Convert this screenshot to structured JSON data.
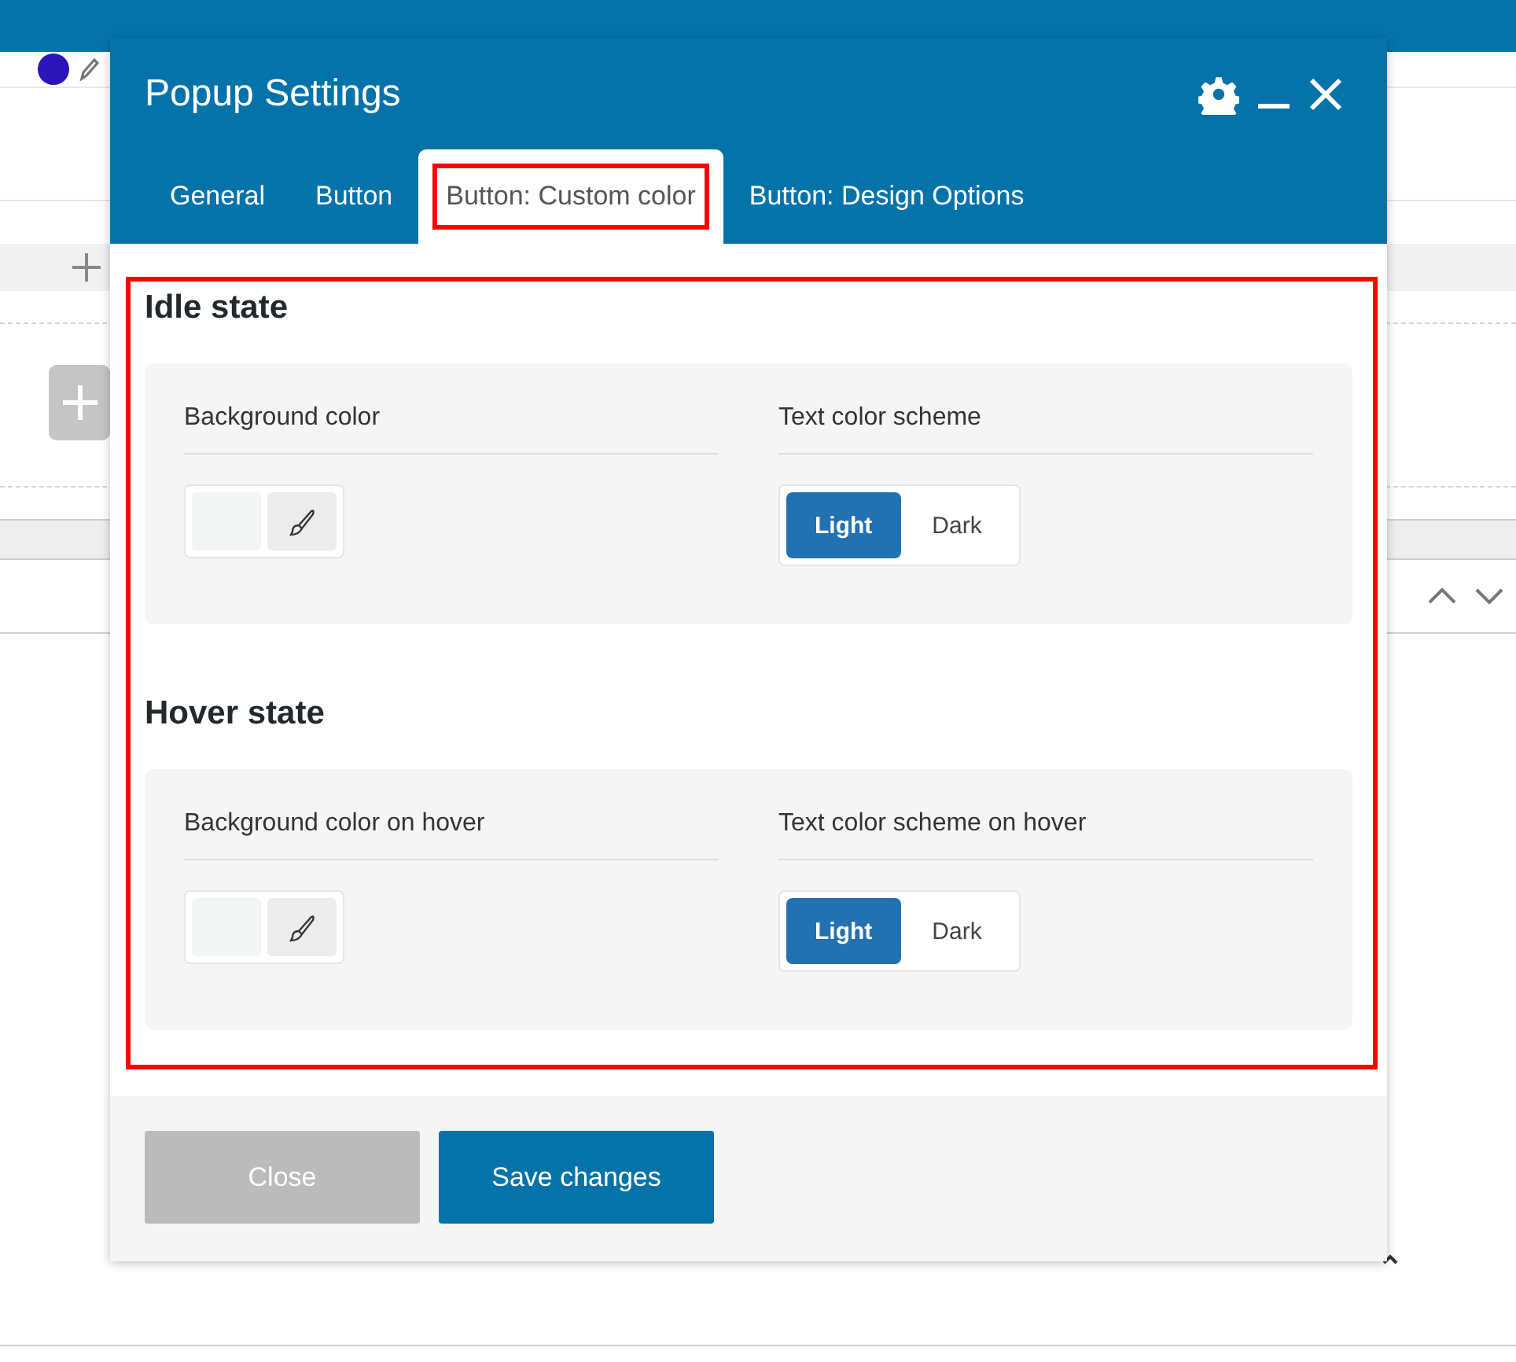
{
  "popup": {
    "title": "Popup Settings",
    "tabs": [
      {
        "label": "General",
        "selected": false,
        "highlighted": false
      },
      {
        "label": "Button",
        "selected": false,
        "highlighted": false
      },
      {
        "label": "Button: Custom color",
        "selected": true,
        "highlighted": true
      },
      {
        "label": "Button: Design Options",
        "selected": false,
        "highlighted": false
      }
    ],
    "content_highlighted": true,
    "sections": [
      {
        "title": "Idle state",
        "fields": [
          {
            "kind": "color",
            "label": "Background color"
          },
          {
            "kind": "toggle",
            "label": "Text color scheme",
            "options": [
              {
                "label": "Light",
                "selected": true
              },
              {
                "label": "Dark",
                "selected": false
              }
            ]
          }
        ]
      },
      {
        "title": "Hover state",
        "fields": [
          {
            "kind": "color",
            "label": "Background color on hover"
          },
          {
            "kind": "toggle",
            "label": "Text color scheme on hover",
            "options": [
              {
                "label": "Light",
                "selected": true
              },
              {
                "label": "Dark",
                "selected": false
              }
            ]
          }
        ]
      }
    ],
    "buttons": [
      {
        "label": "Close",
        "kind": "secondary"
      },
      {
        "label": "Save changes",
        "kind": "primary"
      }
    ]
  }
}
